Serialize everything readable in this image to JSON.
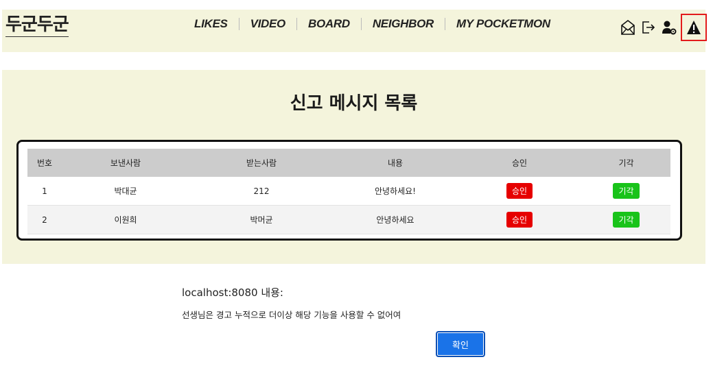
{
  "header": {
    "logo": "두군두군",
    "nav": [
      "LIKES",
      "VIDEO",
      "BOARD",
      "NEIGHBOR",
      "MY POCKETMON"
    ],
    "icons": [
      "mail-icon",
      "logout-icon",
      "user-settings-icon",
      "warning-icon"
    ]
  },
  "page": {
    "title": "신고 메시지 목록"
  },
  "table": {
    "headers": [
      "번호",
      "보낸사람",
      "받는사람",
      "내용",
      "승인",
      "기각"
    ],
    "rows": [
      {
        "no": "1",
        "sender": "박대균",
        "receiver": "212",
        "content": "안녕하세요!",
        "approve": "승인",
        "reject": "기각"
      },
      {
        "no": "2",
        "sender": "이원희",
        "receiver": "박머균",
        "content": "안녕하세요",
        "approve": "승인",
        "reject": "기각"
      }
    ]
  },
  "dialog": {
    "title": "localhost:8080 내용:",
    "message": "선생님은 경고 누적으로 더이상 해당 기능을 사용할 수 없어여",
    "ok_label": "확인"
  },
  "colors": {
    "panel_bg": "#f4f4dc",
    "approve": "#e60000",
    "reject": "#19c31a",
    "ok_button": "#1a73e8",
    "highlight_border": "#e31b1b"
  }
}
